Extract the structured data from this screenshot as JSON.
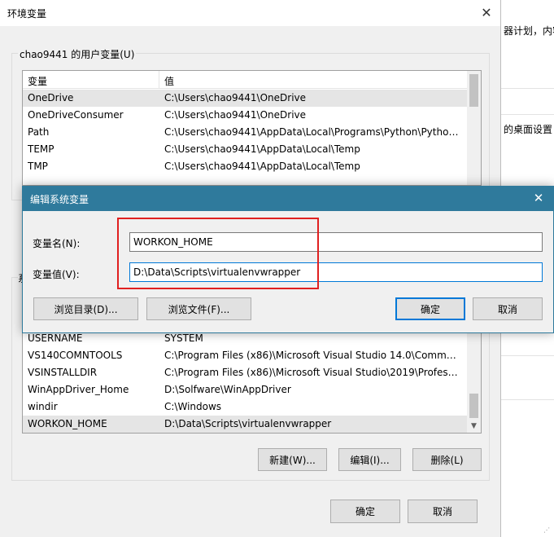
{
  "background_window": {
    "line1": "器计划，内容",
    "line2": "的桌面设置"
  },
  "env_window": {
    "title": "环境变量",
    "user_vars": {
      "group_label": "chao9441 的用户变量(U)",
      "columns": [
        "变量",
        "值"
      ],
      "rows": [
        {
          "name": "OneDrive",
          "value": "C:\\Users\\chao9441\\OneDrive"
        },
        {
          "name": "OneDriveConsumer",
          "value": "C:\\Users\\chao9441\\OneDrive"
        },
        {
          "name": "Path",
          "value": "C:\\Users\\chao9441\\AppData\\Local\\Programs\\Python\\Python..."
        },
        {
          "name": "TEMP",
          "value": "C:\\Users\\chao9441\\AppData\\Local\\Temp"
        },
        {
          "name": "TMP",
          "value": "C:\\Users\\chao9441\\AppData\\Local\\Temp"
        }
      ]
    },
    "system_vars": {
      "group_label_fragment": "系",
      "rows": [
        {
          "name": "USERNAME",
          "value": "SYSTEM"
        },
        {
          "name": "VS140COMNTOOLS",
          "value": "C:\\Program Files (x86)\\Microsoft Visual Studio 14.0\\Common..."
        },
        {
          "name": "VSINSTALLDIR",
          "value": "C:\\Program Files (x86)\\Microsoft Visual Studio\\2019\\Professi..."
        },
        {
          "name": "WinAppDriver_Home",
          "value": "D:\\Solfware\\WinAppDriver"
        },
        {
          "name": "windir",
          "value": "C:\\Windows"
        },
        {
          "name": "WORKON_HOME",
          "value": "D:\\Data\\Scripts\\virtualenvwrapper"
        }
      ],
      "buttons": {
        "new": "新建(W)...",
        "edit": "编辑(I)...",
        "delete": "删除(L)"
      }
    },
    "ok": "确定",
    "cancel": "取消"
  },
  "edit_dialog": {
    "title": "编辑系统变量",
    "name_label": "变量名(N):",
    "name_value": "WORKON_HOME",
    "value_label": "变量值(V):",
    "value_value": "D:\\Data\\Scripts\\virtualenvwrapper",
    "browse_dir": "浏览目录(D)...",
    "browse_file": "浏览文件(F)...",
    "ok": "确定",
    "cancel": "取消"
  }
}
